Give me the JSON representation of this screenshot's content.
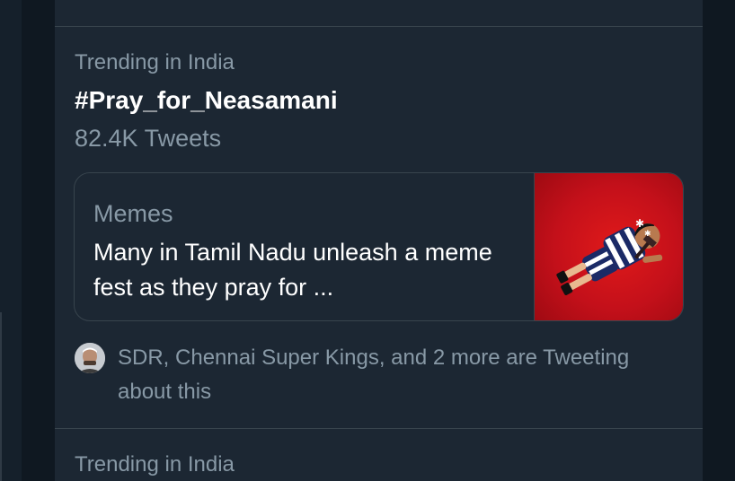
{
  "trends": [
    {
      "context": "Trending in India",
      "name": "#Pray_for_Neasamani",
      "tweet_count": "82.4K Tweets",
      "card": {
        "category": "Memes",
        "headline": "Many in Tamil Nadu unleash a meme fest as they pray for ..."
      },
      "social_context": "SDR, Chennai Super Kings, and 2 more are Tweeting about this"
    },
    {
      "context": "Trending in India"
    }
  ],
  "icons": {
    "avatar": "user-avatar",
    "card_image": "cartoon-figure-thumbnail"
  },
  "colors": {
    "background": "#15202b",
    "panel": "#1c2733",
    "secondary_text": "#8899a6",
    "primary_text": "#ffffff",
    "border": "#38444d",
    "thumbnail_red": "#d0141b"
  }
}
